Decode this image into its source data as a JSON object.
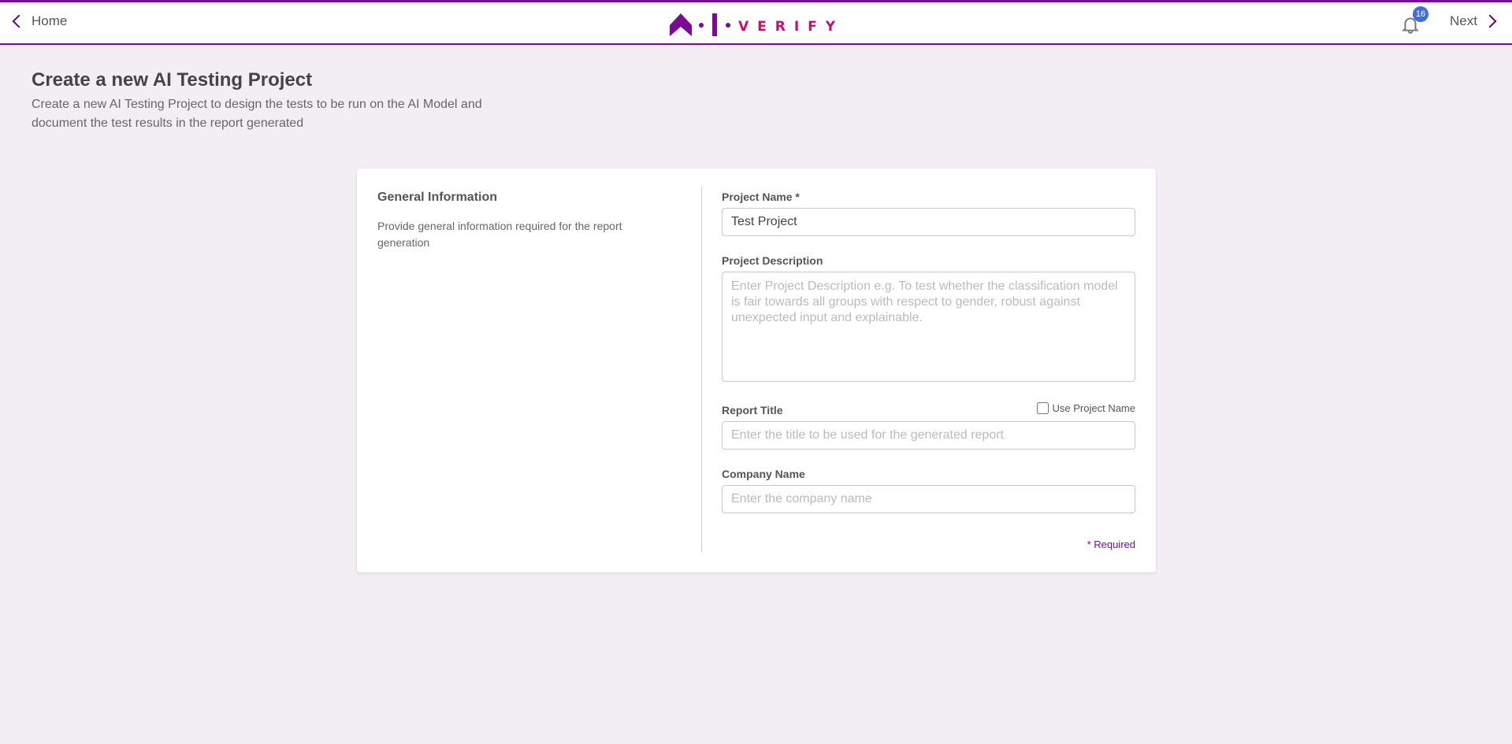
{
  "header": {
    "home_label": "Home",
    "next_label": "Next",
    "notification_count": "16",
    "logo_text": "A·I·VERIFY",
    "brand_color": "#7b0a94",
    "accent_color": "#c0106f"
  },
  "page": {
    "title": "Create a new AI Testing Project",
    "subtitle": "Create a new AI Testing Project to design the tests to be run on the AI Model and document the test results in the report generated"
  },
  "section": {
    "heading": "General Information",
    "description": "Provide general information required for the report generation"
  },
  "form": {
    "project_name": {
      "label": "Project Name *",
      "value": "Test Project"
    },
    "project_description": {
      "label": "Project Description",
      "placeholder": "Enter Project Description e.g. To test whether the classification model is fair towards all groups with respect to gender, robust against unexpected input and explainable."
    },
    "report_title": {
      "label": "Report Title",
      "placeholder": "Enter the title to be used for the generated report",
      "checkbox_label": "Use Project Name",
      "checked": false
    },
    "company_name": {
      "label": "Company Name",
      "placeholder": "Enter the company name"
    },
    "required_note": "* Required"
  }
}
